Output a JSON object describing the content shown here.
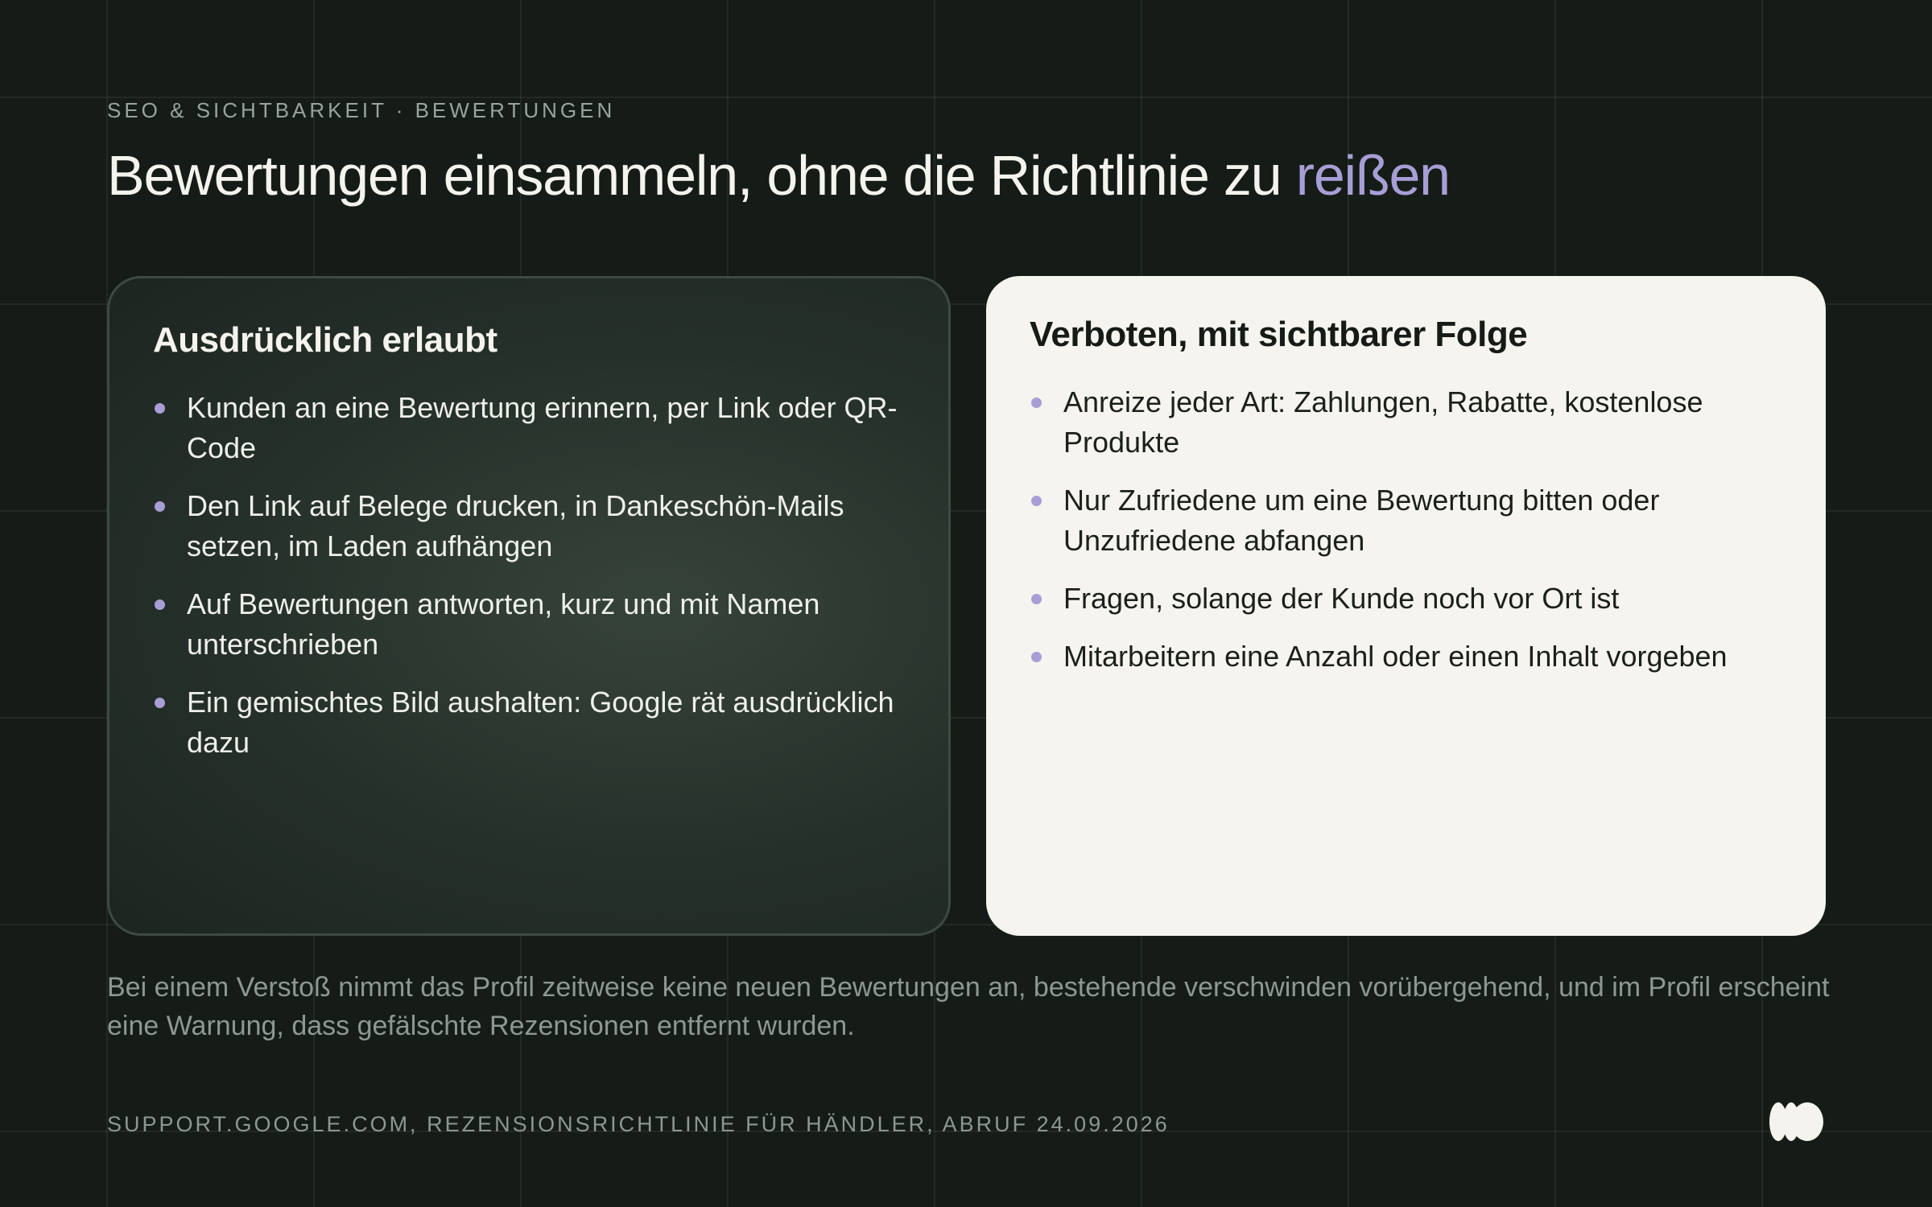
{
  "eyebrow": "SEO & SICHTBARKEIT · BEWERTUNGEN",
  "title": {
    "main": "Bewertungen einsammeln, ohne die Richtlinie zu ",
    "accent": "reißen"
  },
  "allowed": {
    "heading": "Ausdrücklich erlaubt",
    "items": [
      "Kunden an eine Bewertung erinnern, per Link oder QR-Code",
      "Den Link auf Belege drucken, in Dankeschön-Mails setzen, im Laden aufhängen",
      "Auf Bewertungen antworten, kurz und mit Namen unterschrieben",
      "Ein gemischtes Bild aushalten: Google rät ausdrücklich dazu"
    ]
  },
  "forbidden": {
    "heading": "Verboten, mit sichtbarer Folge",
    "items": [
      "Anreize jeder Art: Zahlungen, Rabatte, kostenlose Produkte",
      "Nur Zufriedene um eine Bewertung bitten oder Unzufriedene abfangen",
      "Fragen, solange der Kunde noch vor Ort ist",
      "Mitarbeitern eine Anzahl oder einen Inhalt vorgeben"
    ]
  },
  "note": "Bei einem Verstoß nimmt das Profil zeitweise keine neuen Bewertungen an, bestehende verschwinden vorübergehend, und im Profil erscheint eine Warnung, dass gefälschte Rezensionen entfernt wurden.",
  "source": "SUPPORT.GOOGLE.COM, REZENSIONSRICHTLINIE FÜR HÄNDLER, ABRUF 24.09.2026",
  "logo": {
    "icon": "brand-logo-icon"
  },
  "colors": {
    "background": "#151c17",
    "accent": "#a89ed6",
    "card_light": "#f5f4ef",
    "text_light": "#f4f3ee"
  }
}
